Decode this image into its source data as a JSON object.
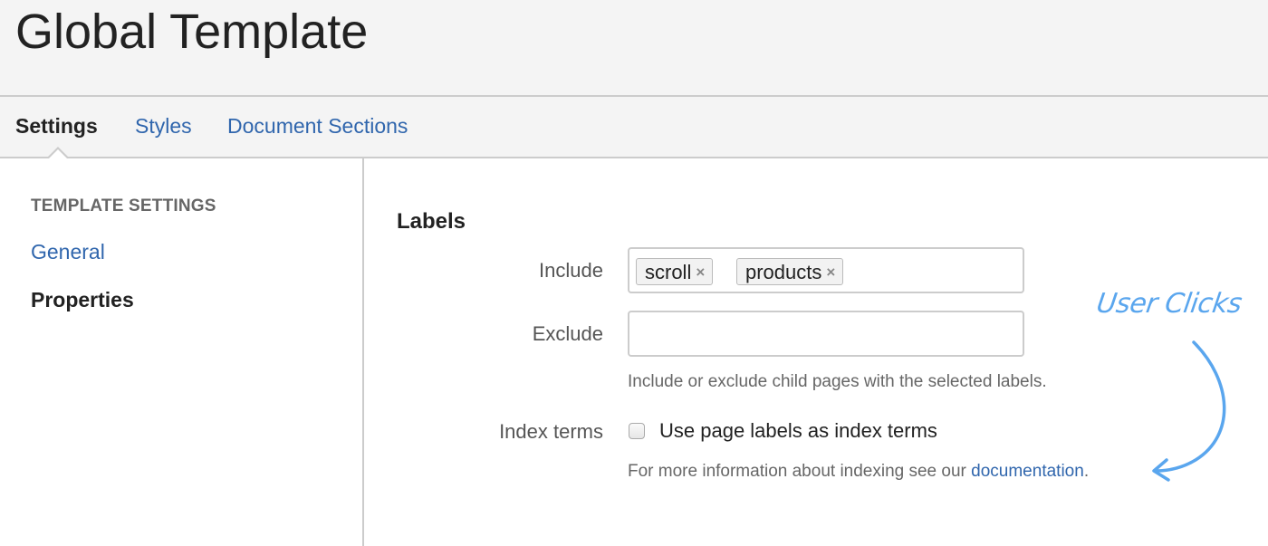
{
  "header": {
    "title": "Global Template"
  },
  "tabs": [
    {
      "label": "Settings",
      "active": true
    },
    {
      "label": "Styles",
      "active": false
    },
    {
      "label": "Document Sections",
      "active": false
    }
  ],
  "sidebar": {
    "heading": "TEMPLATE SETTINGS",
    "items": [
      {
        "label": "General",
        "active": false
      },
      {
        "label": "Properties",
        "active": true
      }
    ]
  },
  "main": {
    "section_heading": "Labels",
    "include": {
      "label": "Include",
      "tags": [
        {
          "text": "scroll",
          "remove_glyph": "×"
        },
        {
          "text": "products",
          "remove_glyph": "×"
        }
      ]
    },
    "exclude": {
      "label": "Exclude",
      "value": ""
    },
    "labels_help": "Include or exclude child pages with the selected labels.",
    "index_terms": {
      "label": "Index terms",
      "checkbox_label": "Use page labels as index terms",
      "checked": false
    },
    "index_help_prefix": "For more information about indexing see our ",
    "index_help_link": "documentation",
    "index_help_suffix": "."
  },
  "annotation": {
    "text": "User Clicks",
    "color": "#5aa6ee",
    "icon": "curved-arrow-icon"
  },
  "colors": {
    "link": "#3066ad",
    "header_bg": "#f4f4f4",
    "border": "#cccccc"
  }
}
